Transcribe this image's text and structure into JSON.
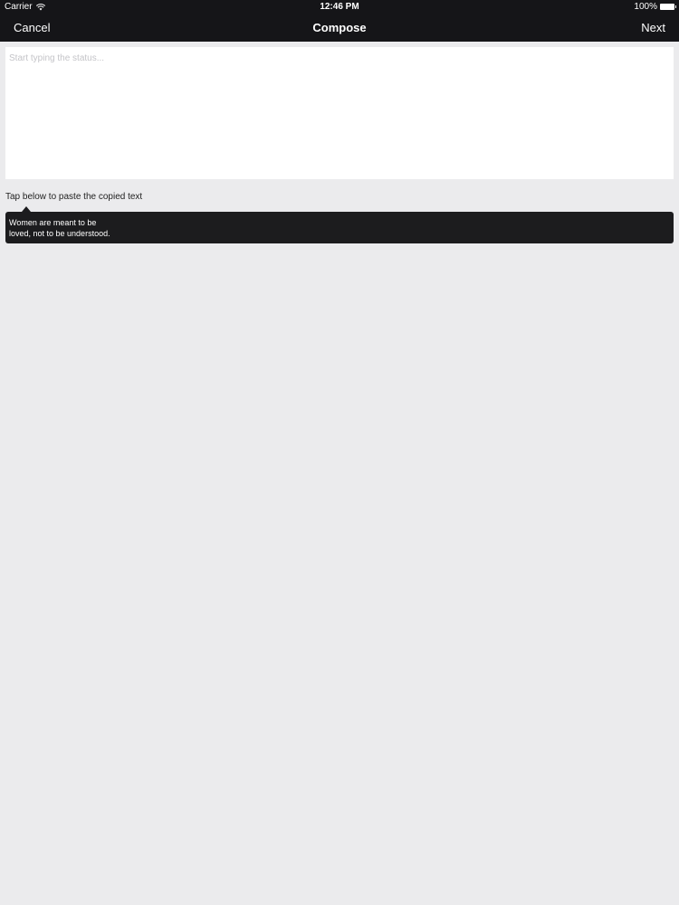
{
  "status_bar": {
    "carrier": "Carrier",
    "time": "12:46 PM",
    "battery": "100%"
  },
  "nav": {
    "cancel_label": "Cancel",
    "title": "Compose",
    "next_label": "Next"
  },
  "compose": {
    "placeholder": "Start typing the status...",
    "value": ""
  },
  "paste": {
    "hint": "Tap below to paste the copied text",
    "lines": [
      "Women are meant to be",
      "loved, not to be understood."
    ]
  }
}
